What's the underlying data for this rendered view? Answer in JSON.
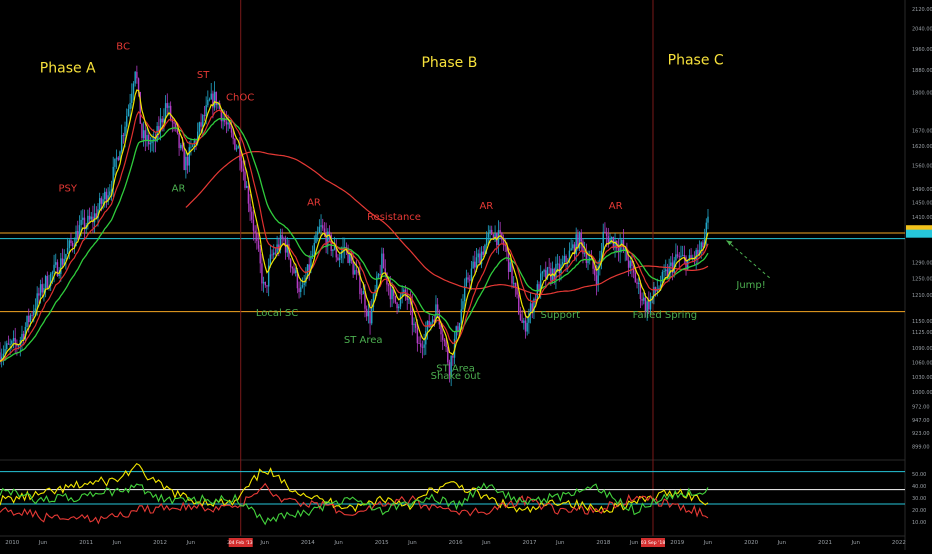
{
  "chart_data": [
    {
      "type": "candlestick",
      "panel": "price",
      "y_scale": "log",
      "ylim": [
        878,
        2130
      ],
      "x_range": [
        "2009-11",
        "2022-02"
      ],
      "y_ticks": [
        2120.0,
        2040.0,
        1960.0,
        1880.0,
        1800.0,
        1670.0,
        1620.0,
        1560.0,
        1490.0,
        1450.0,
        1410.0,
        1370.0,
        1290.0,
        1250.0,
        1210.0,
        1150.0,
        1125.0,
        1090.0,
        1060.0,
        1030.0,
        1000.0,
        972.0,
        947.0,
        923.0,
        899.0
      ],
      "y_tick_labels": [
        "2120.00",
        "2040.00",
        "1960.00",
        "1880.00",
        "1800.00",
        "1670.00",
        "1620.00",
        "1560.00",
        "1490.00",
        "1450.00",
        "1410.00",
        "1370.00",
        "1290.00",
        "1250.00",
        "1210.00",
        "1150.00",
        "1125.00",
        "1090.00",
        "1060.00",
        "1030.00",
        "1000.00",
        "972.00",
        "947.00",
        "923.00",
        "899.00"
      ],
      "price_path": [
        [
          "2009-11",
          1080
        ],
        [
          "2010-02",
          1100
        ],
        [
          "2010-06",
          1230
        ],
        [
          "2010-09",
          1290
        ],
        [
          "2010-12",
          1380
        ],
        [
          "2011-02",
          1400
        ],
        [
          "2011-05",
          1500
        ],
        [
          "2011-08",
          1760
        ],
        [
          "2011-09",
          1900
        ],
        [
          "2011-10",
          1650
        ],
        [
          "2011-12",
          1620
        ],
        [
          "2012-02",
          1760
        ],
        [
          "2012-05",
          1560
        ],
        [
          "2012-06",
          1600
        ],
        [
          "2012-09",
          1760
        ],
        [
          "2012-10",
          1780
        ],
        [
          "2012-12",
          1670
        ],
        [
          "2013-02",
          1600
        ],
        [
          "2013-04",
          1400
        ],
        [
          "2013-06",
          1210
        ],
        [
          "2013-07",
          1300
        ],
        [
          "2013-09",
          1350
        ],
        [
          "2013-12",
          1210
        ],
        [
          "2014-03",
          1380
        ],
        [
          "2014-06",
          1300
        ],
        [
          "2014-07",
          1330
        ],
        [
          "2014-10",
          1210
        ],
        [
          "2014-11",
          1150
        ],
        [
          "2015-01",
          1290
        ],
        [
          "2015-03",
          1190
        ],
        [
          "2015-05",
          1210
        ],
        [
          "2015-07",
          1090
        ],
        [
          "2015-10",
          1180
        ],
        [
          "2015-12",
          1050
        ],
        [
          "2016-03",
          1250
        ],
        [
          "2016-07",
          1370
        ],
        [
          "2016-09",
          1330
        ],
        [
          "2016-12",
          1130
        ],
        [
          "2017-03",
          1250
        ],
        [
          "2017-06",
          1270
        ],
        [
          "2017-09",
          1350
        ],
        [
          "2017-12",
          1250
        ],
        [
          "2018-01",
          1360
        ],
        [
          "2018-04",
          1330
        ],
        [
          "2018-08",
          1180
        ],
        [
          "2018-10",
          1230
        ],
        [
          "2019-01",
          1300
        ],
        [
          "2019-03",
          1290
        ],
        [
          "2019-05",
          1320
        ],
        [
          "2019-06",
          1395
        ]
      ],
      "horizontal_levels": [
        {
          "value": 1365,
          "color": "#f5a623"
        },
        {
          "value": 1350,
          "color": "#26c6da"
        },
        {
          "value": 1170,
          "color": "#f5a623"
        }
      ],
      "x_tick_labels": [
        "2010",
        "Jun",
        "2011",
        "Jun",
        "2012",
        "Jun",
        "2013",
        "Jun",
        "2014",
        "Jun",
        "2015",
        "Jun",
        "2016",
        "Jun",
        "2017",
        "Jun",
        "2018",
        "Jun",
        "2019",
        "Jun",
        "2020",
        "Jun",
        "2021",
        "Jun",
        "2022"
      ],
      "x_tick_dates": [
        "2010-01",
        "2010-06",
        "2011-01",
        "2011-06",
        "2012-01",
        "2012-06",
        "2013-01",
        "2013-06",
        "2014-01",
        "2014-06",
        "2015-01",
        "2015-06",
        "2016-01",
        "2016-06",
        "2017-01",
        "2017-06",
        "2018-01",
        "2018-06",
        "2019-01",
        "2019-06",
        "2020-01",
        "2020-06",
        "2021-01",
        "2021-06",
        "2022-01"
      ],
      "date_markers": [
        {
          "date": "2013-02-04",
          "label": "04 Feb '13"
        },
        {
          "date": "2018-09-03",
          "label": "03 Sep '18"
        }
      ],
      "current_price_labels": [
        {
          "value": 1375,
          "color": "#f2c21b"
        },
        {
          "value": 1363,
          "color": "#26c6da"
        }
      ],
      "annotations": [
        {
          "text": "Phase A",
          "date": "2010-10",
          "price": 1870,
          "color": "#f7e13b"
        },
        {
          "text": "BC",
          "date": "2011-07",
          "price": 1955,
          "color": "#e53935"
        },
        {
          "text": "ST",
          "date": "2012-08",
          "price": 1850,
          "color": "#e53935"
        },
        {
          "text": "ChOC",
          "date": "2013-02",
          "price": 1770,
          "color": "#e53935"
        },
        {
          "text": "PSY",
          "date": "2010-10",
          "price": 1480,
          "color": "#e53935"
        },
        {
          "text": "AR",
          "date": "2012-04",
          "price": 1480,
          "color": "#4caf50"
        },
        {
          "text": "AR",
          "date": "2014-02",
          "price": 1440,
          "color": "#e53935"
        },
        {
          "text": "Resistance",
          "date": "2015-03",
          "price": 1400,
          "color": "#e53935"
        },
        {
          "text": "AR",
          "date": "2016-06",
          "price": 1430,
          "color": "#e53935"
        },
        {
          "text": "AR",
          "date": "2018-03",
          "price": 1430,
          "color": "#e53935"
        },
        {
          "text": "Phase B",
          "date": "2015-12",
          "price": 1890,
          "color": "#f7e13b"
        },
        {
          "text": "Phase C",
          "date": "2019-04",
          "price": 1900,
          "color": "#f7e13b"
        },
        {
          "text": "Local SC",
          "date": "2013-08",
          "price": 1160,
          "color": "#4caf50"
        },
        {
          "text": "ST Area",
          "date": "2014-10",
          "price": 1100,
          "color": "#4caf50"
        },
        {
          "text": "ST Area",
          "date": "2016-00",
          "price": 1040,
          "color": "#4caf50"
        },
        {
          "text": "Shake out",
          "date": "2016-00",
          "price": 1025,
          "color": "#4caf50"
        },
        {
          "text": "Support",
          "date": "2017-06",
          "price": 1155,
          "color": "#4caf50"
        },
        {
          "text": "Failed Spring",
          "date": "2018-11",
          "price": 1155,
          "color": "#4caf50"
        },
        {
          "text": "Jump!",
          "date": "2020-01",
          "price": 1225,
          "color": "#4caf50"
        }
      ],
      "vertical_lines": [
        "2013-02-04",
        "2018-09-03"
      ]
    },
    {
      "type": "line",
      "panel": "oscillator",
      "ylim": [
        0,
        60
      ],
      "y_ticks": [
        50,
        40,
        30,
        20,
        10
      ],
      "y_tick_labels": [
        "50.00",
        "40.00",
        "30.00",
        "20.00",
        "10.00"
      ],
      "levels": [
        {
          "value": 52,
          "color": "#26c6da"
        },
        {
          "value": 37,
          "color": "#ffffff"
        },
        {
          "value": 25,
          "color": "#26c6da"
        }
      ],
      "series": [
        {
          "color": "#f2e600",
          "x": [
            "2009-11",
            "2010-06",
            "2011-01",
            "2011-06",
            "2011-09",
            "2012-01",
            "2012-06",
            "2013-01",
            "2013-06",
            "2013-09",
            "2014-03",
            "2014-09",
            "2015-01",
            "2015-06",
            "2015-09",
            "2016-01",
            "2016-06",
            "2016-12",
            "2017-06",
            "2017-12",
            "2018-06",
            "2019-01",
            "2019-06"
          ],
          "values": [
            28,
            33,
            42,
            45,
            56,
            40,
            28,
            25,
            55,
            42,
            28,
            22,
            30,
            24,
            36,
            42,
            30,
            18,
            28,
            20,
            26,
            36,
            26
          ]
        },
        {
          "color": "#e53935",
          "x": [
            "2009-11",
            "2010-06",
            "2011-01",
            "2011-06",
            "2011-09",
            "2012-01",
            "2012-06",
            "2013-01",
            "2013-06",
            "2013-09",
            "2014-03",
            "2014-09",
            "2015-01",
            "2015-06",
            "2015-09",
            "2016-01",
            "2016-06",
            "2016-12",
            "2017-06",
            "2017-12",
            "2018-06",
            "2019-01",
            "2019-06"
          ],
          "values": [
            22,
            14,
            12,
            14,
            20,
            22,
            24,
            20,
            42,
            28,
            24,
            18,
            26,
            28,
            22,
            16,
            20,
            28,
            20,
            20,
            30,
            24,
            16
          ]
        },
        {
          "color": "#43d13c",
          "x": [
            "2009-11",
            "2010-06",
            "2011-01",
            "2011-06",
            "2011-09",
            "2012-01",
            "2012-06",
            "2013-01",
            "2013-06",
            "2013-09",
            "2014-03",
            "2014-09",
            "2015-01",
            "2015-06",
            "2015-09",
            "2016-01",
            "2016-06",
            "2016-12",
            "2017-06",
            "2017-12",
            "2018-06",
            "2019-01",
            "2019-06"
          ],
          "values": [
            36,
            28,
            32,
            36,
            40,
            30,
            28,
            30,
            12,
            14,
            22,
            30,
            20,
            26,
            30,
            24,
            40,
            28,
            30,
            38,
            20,
            34,
            36
          ]
        }
      ]
    }
  ]
}
